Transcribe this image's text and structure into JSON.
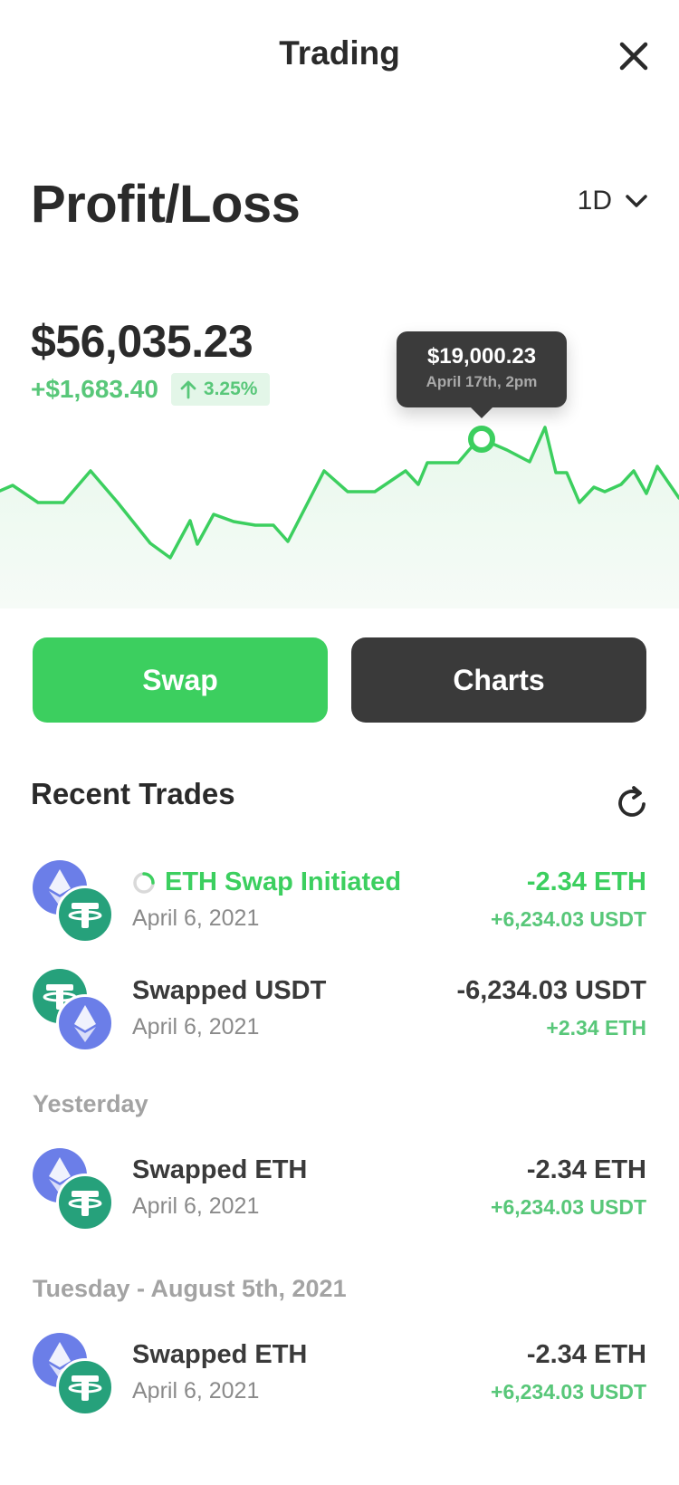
{
  "header": {
    "title": "Trading"
  },
  "portfolio": {
    "title": "Profit/Loss",
    "range": "1D",
    "balance": "$56,035.23",
    "change_amount": "+$1,683.40",
    "change_percent": "3.25%"
  },
  "tooltip": {
    "value": "$19,000.23",
    "date": "April 17th, 2pm"
  },
  "actions": {
    "swap_label": "Swap",
    "charts_label": "Charts"
  },
  "recent": {
    "title": "Recent Trades",
    "groups": [
      {
        "label": ""
      },
      {
        "label": "Yesterday"
      },
      {
        "label": "Tuesday - August 5th, 2021"
      }
    ],
    "trades": [
      {
        "name": "ETH Swap Initiated",
        "date": "April 6, 2021",
        "main": "-2.34 ETH",
        "sub": "+6,234.03 USDT",
        "status": "pending"
      },
      {
        "name": "Swapped USDT",
        "date": "April 6, 2021",
        "main": "-6,234.03 USDT",
        "sub": "+2.34 ETH",
        "status": "done"
      },
      {
        "name": "Swapped ETH",
        "date": "April 6, 2021",
        "main": "-2.34 ETH",
        "sub": "+6,234.03 USDT",
        "status": "done"
      },
      {
        "name": "Swapped ETH",
        "date": "April 6, 2021",
        "main": "-2.34 ETH",
        "sub": "+6,234.03 USDT",
        "status": "done"
      }
    ]
  },
  "colors": {
    "accent_green": "#3ccf5f",
    "dark_button": "#3a3a3a",
    "muted_label": "#a3a3a3"
  }
}
